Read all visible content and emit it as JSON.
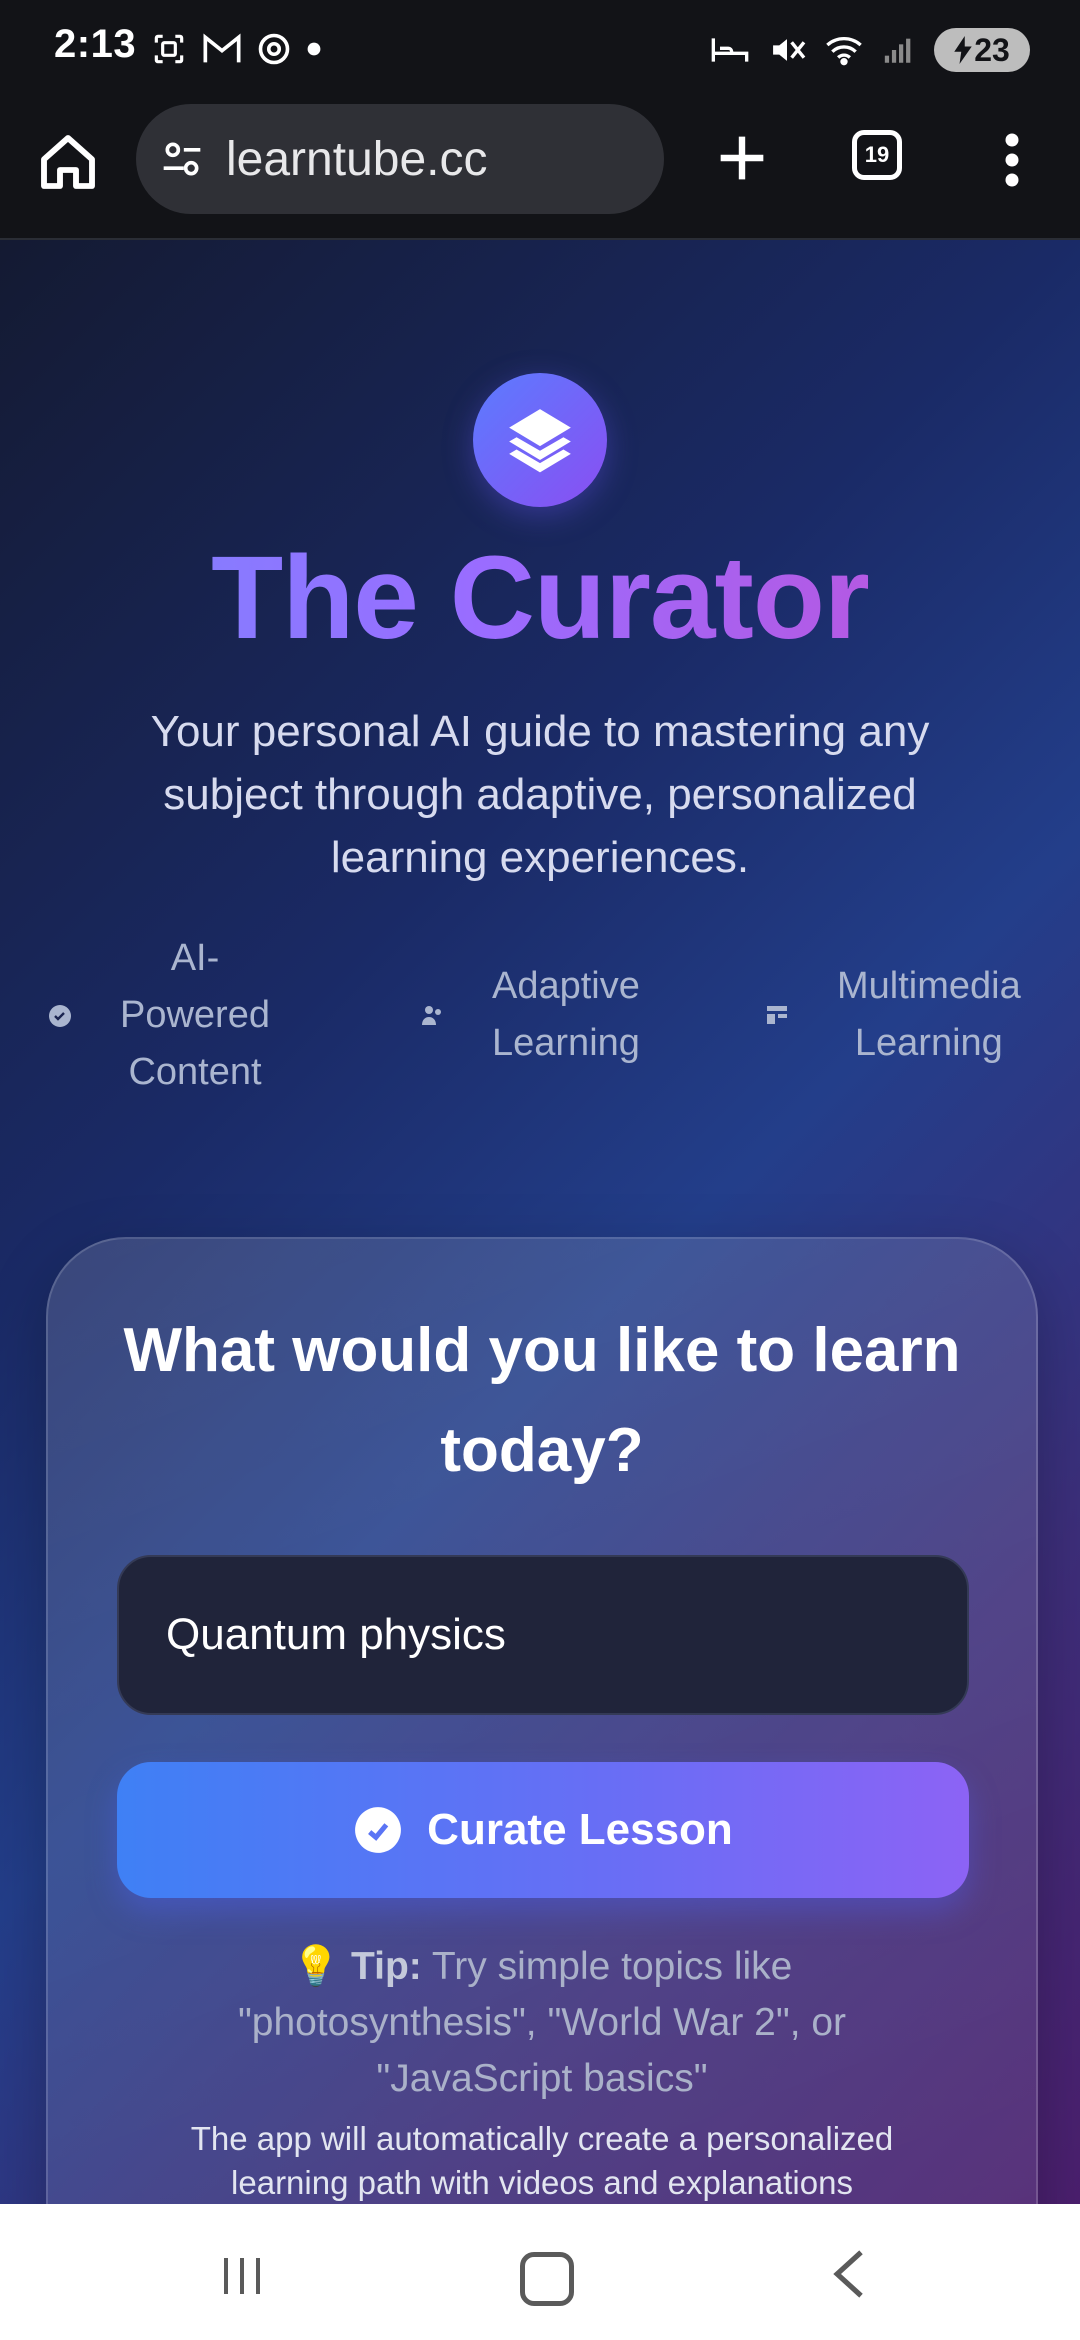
{
  "status_bar": {
    "time": "2:13",
    "battery": "23",
    "left_icons": [
      "screenshot-icon",
      "gmail-icon",
      "chrome-icon",
      "dot-icon"
    ],
    "right_icons": [
      "bed-icon",
      "mute-icon",
      "wifi-icon",
      "signal-icon"
    ]
  },
  "browser": {
    "url": "learntube.cc",
    "tab_count": "19"
  },
  "hero": {
    "title": "The Curator",
    "subtitle": "Your personal AI guide to mastering any subject through adaptive, personalized learning experiences.",
    "features": [
      {
        "label": "AI-\nPowered\nContent",
        "icon": "check-circle-icon"
      },
      {
        "label": "Adaptive\nLearning",
        "icon": "users-icon"
      },
      {
        "label": "Multimedia\nLearning",
        "icon": "layout-icon"
      }
    ]
  },
  "card": {
    "title": "What would you like to learn today?",
    "input_value": "Quantum physics",
    "button_label": "Curate Lesson",
    "tip_icon": "💡",
    "tip_label": "Tip:",
    "tip_text": " Try simple topics like \"photosynthesis\", \"World War 2\", or \"JavaScript basics\"",
    "note": "The app will automatically create a personalized learning path with videos and explanations"
  },
  "colors": {
    "accent_blue": "#3f80f5",
    "accent_purple": "#8c63f5",
    "title_gradient_start": "#7a86ff",
    "title_gradient_end": "#c24fd4"
  }
}
